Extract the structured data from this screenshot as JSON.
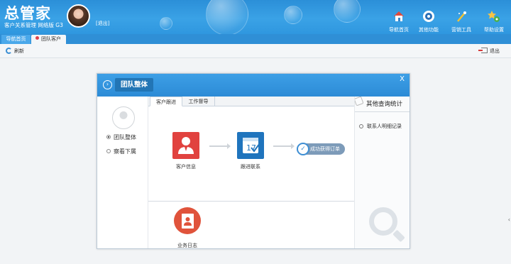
{
  "app": {
    "logo": "总管家",
    "subtitle": "客户关系管理 网络版 G3",
    "logout_link": "[退出]"
  },
  "toolbar_top": [
    {
      "label": "导航首页",
      "icon": "home-icon"
    },
    {
      "label": "其他功能",
      "icon": "disc-icon"
    },
    {
      "label": "营销工具",
      "icon": "magic-wand-icon"
    },
    {
      "label": "帮助设置",
      "icon": "stars-gear-icon"
    }
  ],
  "tabs": [
    {
      "label": "导航首页"
    },
    {
      "label": "团队客户"
    }
  ],
  "actions": {
    "refresh": "刷新",
    "exit": "退出"
  },
  "dialog": {
    "title": "团队整体",
    "close": "X",
    "radios": [
      {
        "label": "团队整体",
        "selected": true
      },
      {
        "label": "察看下属",
        "selected": false
      }
    ],
    "tabs": [
      "客户跟进",
      "工作督导"
    ],
    "flow": {
      "customer_info": "客户信息",
      "follow_up": "跟进联系",
      "success": "成功获得订单",
      "calendar_day": "17"
    },
    "work_log": "业务日志",
    "right": {
      "header": "其他查询统计",
      "item": "联系人明细记录"
    }
  },
  "colors": {
    "header_blue": "#3aa2e6",
    "red_tile": "#e1423f",
    "blue_tile": "#1f74bd",
    "success_pill": "#7d9bb9"
  }
}
